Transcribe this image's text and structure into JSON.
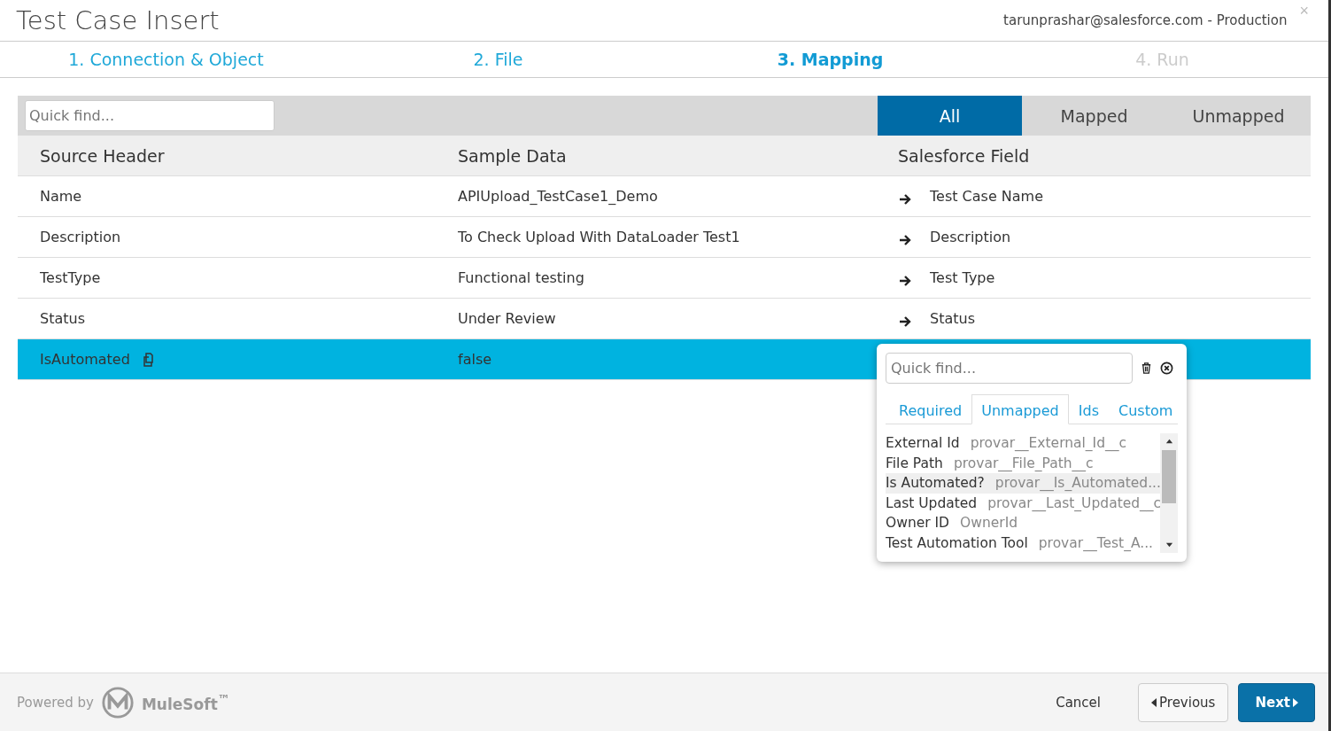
{
  "window": {
    "title": "Test Case Insert",
    "account": "tarunprashar@salesforce.com - Production",
    "close": "×"
  },
  "steps": [
    {
      "label": "1. Connection & Object",
      "selected": false,
      "disabled": false
    },
    {
      "label": "2. File",
      "selected": false,
      "disabled": false
    },
    {
      "label": "3. Mapping",
      "selected": true,
      "disabled": false
    },
    {
      "label": "4. Run",
      "selected": false,
      "disabled": true
    }
  ],
  "toolbar": {
    "search": {
      "placeholder": "Quick find..."
    },
    "filters": [
      {
        "label": "All",
        "selected": true
      },
      {
        "label": "Mapped",
        "selected": false
      },
      {
        "label": "Unmapped",
        "selected": false
      }
    ]
  },
  "table": {
    "columns": [
      "Source Header",
      "Sample Data",
      "Salesforce Field"
    ],
    "rows": [
      {
        "source": "Name",
        "sample": "APIUpload_TestCase1_Demo",
        "field": "Test Case Name",
        "selected": false
      },
      {
        "source": "Description",
        "sample": "To Check Upload With DataLoader Test1",
        "field": "Description",
        "selected": false
      },
      {
        "source": "TestType",
        "sample": "Functional testing",
        "field": "Test Type",
        "selected": false
      },
      {
        "source": "Status",
        "sample": "Under Review",
        "field": "Status",
        "selected": false
      },
      {
        "source": "IsAutomated",
        "sample": "false",
        "selected": true
      }
    ]
  },
  "field_picker": {
    "search": {
      "placeholder": "Quick find..."
    },
    "tabs": [
      {
        "label": "Required",
        "selected": false
      },
      {
        "label": "Unmapped",
        "selected": true
      },
      {
        "label": "Ids",
        "selected": false
      },
      {
        "label": "Custom",
        "selected": false
      }
    ],
    "items": [
      {
        "label": "External Id",
        "api_name": "provar__External_Id__c",
        "selected": false
      },
      {
        "label": "File Path",
        "api_name": "provar__File_Path__c",
        "selected": false
      },
      {
        "label": "Is Automated?",
        "api_name": "provar__Is_Automated...",
        "selected": true
      },
      {
        "label": "Last Updated",
        "api_name": "provar__Last_Updated__c",
        "selected": false
      },
      {
        "label": "Owner ID",
        "api_name": "OwnerId",
        "selected": false
      },
      {
        "label": "Test Automation Tool",
        "api_name": "provar__Test_A...",
        "selected": false
      }
    ]
  },
  "footer": {
    "powered_by": "Powered by",
    "brand": "MuleSoft$^{™}$",
    "buttons": [
      {
        "label": "Cancel",
        "kind": "link"
      },
      {
        "label": "Previous",
        "kind": "back"
      },
      {
        "label": "Next",
        "kind": "primary"
      }
    ]
  }
}
